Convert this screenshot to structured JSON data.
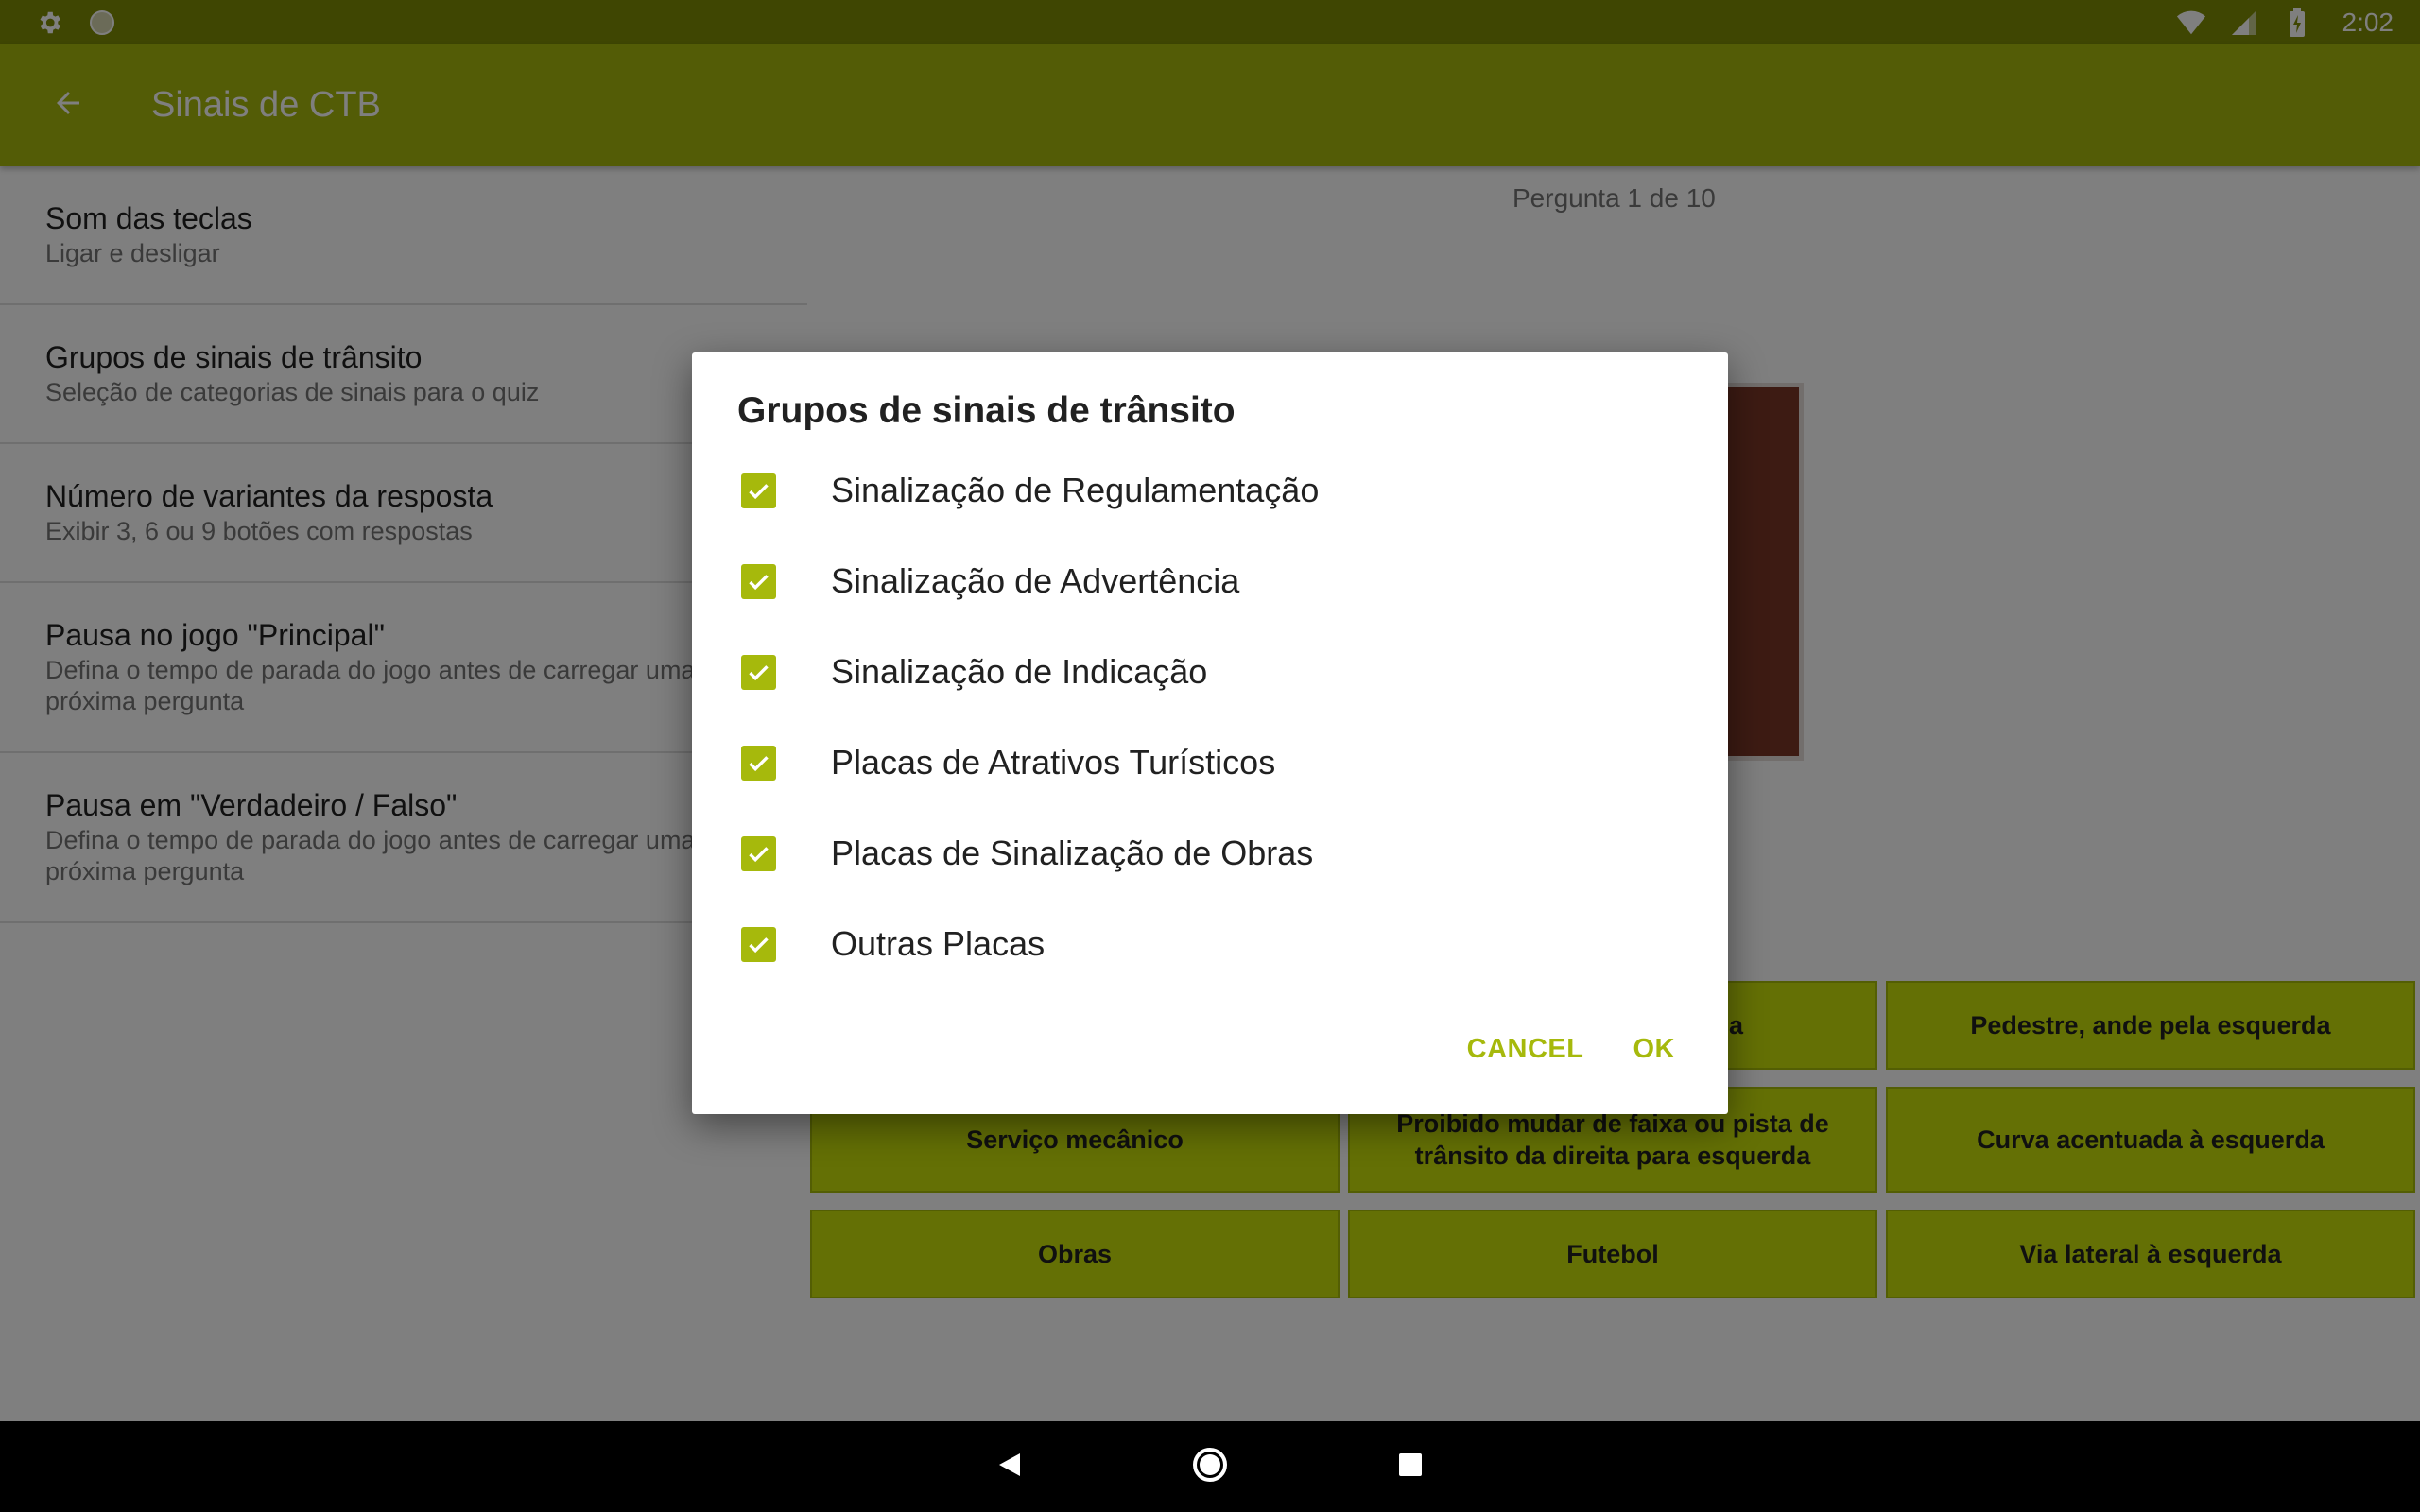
{
  "status_bar": {
    "time": "2:02",
    "left_icons": [
      "settings-gear-icon",
      "circle-notification-icon"
    ],
    "right_icons": [
      "wifi-icon",
      "cell-signal-icon",
      "battery-charging-icon"
    ]
  },
  "app_bar": {
    "title": "Sinais de CTB",
    "back_icon": "arrow-back-icon"
  },
  "settings": [
    {
      "title": "Som das teclas",
      "summary": "Ligar e desligar"
    },
    {
      "title": "Grupos de sinais de trânsito",
      "summary": "Seleção de categorias de sinais para o quiz"
    },
    {
      "title": "Número de variantes da resposta",
      "summary": "Exibir 3, 6 ou 9 botões com respostas"
    },
    {
      "title": "Pausa no jogo \"Principal\"",
      "summary": "Defina o tempo de parada do jogo antes de carregar uma próxima pergunta"
    },
    {
      "title": "Pausa em \"Verdadeiro / Falso\"",
      "summary": "Defina o tempo de parada do jogo antes de carregar uma próxima pergunta"
    }
  ],
  "quiz": {
    "counter": "Pergunta 1 de 10",
    "answers": [
      "",
      "a",
      "Pedestre, ande pela esquerda",
      "Serviço mecânico",
      "Proibido mudar de faixa ou pista de trânsito da direita para esquerda",
      "Curva acentuada à esquerda",
      "Obras",
      "Futebol",
      "Via lateral à esquerda"
    ]
  },
  "dialog": {
    "title": "Grupos de sinais de trânsito",
    "options": [
      {
        "label": "Sinalização de Regulamentação",
        "checked": true
      },
      {
        "label": "Sinalização de Advertência",
        "checked": true
      },
      {
        "label": "Sinalização de Indicação",
        "checked": true
      },
      {
        "label": "Placas de Atrativos Turísticos",
        "checked": true
      },
      {
        "label": "Placas de Sinalização de Obras",
        "checked": true
      },
      {
        "label": "Outras Placas",
        "checked": true
      }
    ],
    "cancel_label": "CANCEL",
    "ok_label": "OK"
  },
  "nav_bar": {
    "icons": [
      "back-triangle-icon",
      "home-circle-icon",
      "recents-square-icon"
    ]
  },
  "colors": {
    "status_bar": "#7e8c05",
    "app_bar": "#a6b90c",
    "accent": "#a6b90c",
    "answer_button": "#c8e00a",
    "sign_brown": "#7a3726"
  }
}
